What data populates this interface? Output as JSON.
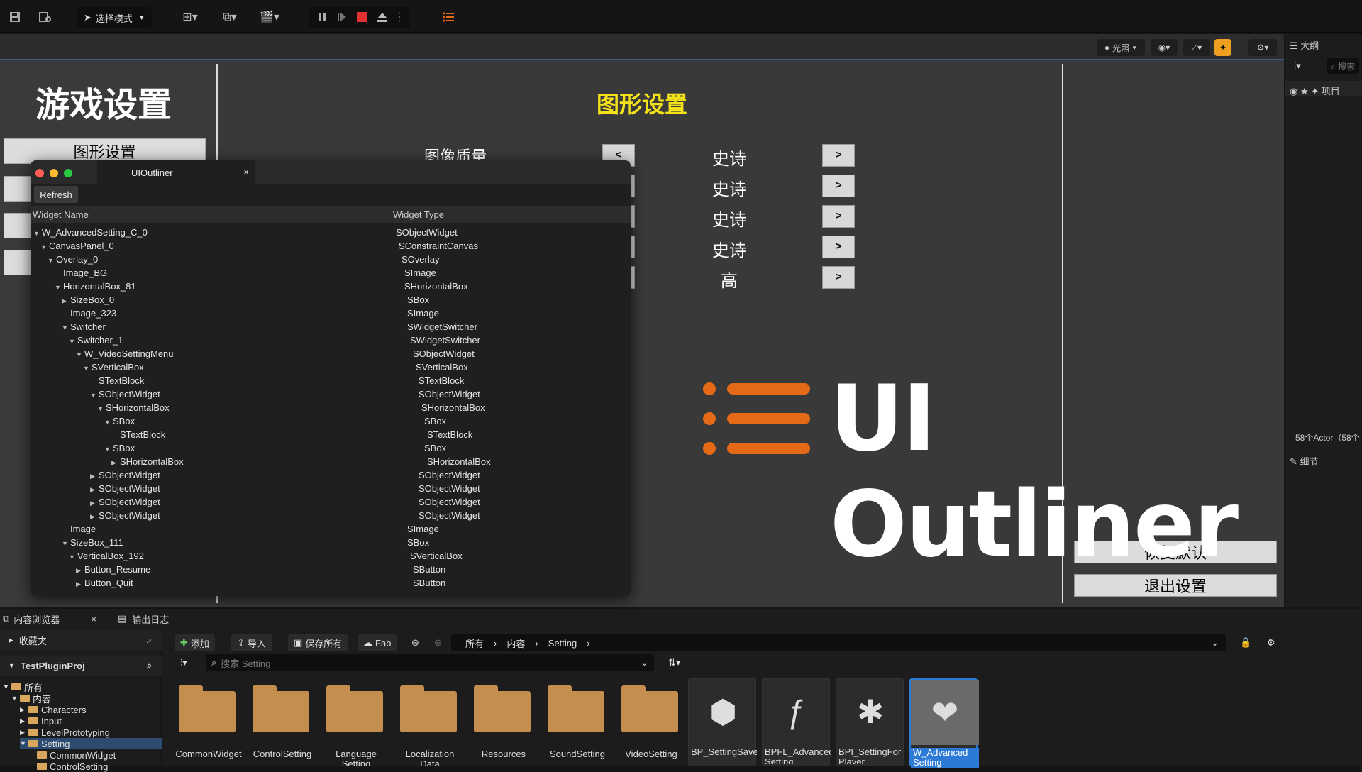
{
  "toolbar": {
    "mode_label": "选择模式"
  },
  "viewport_bar": {
    "lighting_label": "光照"
  },
  "game": {
    "title": "游戏设置",
    "menu": [
      "图形设置"
    ],
    "section_title": "图形设置",
    "row1_label": "图像质量",
    "prev_glyph": "<",
    "next_glyph": ">",
    "values": [
      "史诗",
      "史诗",
      "史诗",
      "史诗",
      "高"
    ],
    "restore_label": "恢复默认",
    "exit_label": "退出设置"
  },
  "logo": {
    "text": "UI Outliner",
    "accent": "#e56a18"
  },
  "outliner_window": {
    "tab_title": "UIOutliner",
    "close_glyph": "×",
    "refresh_label": "Refresh",
    "col_name": "Widget Name",
    "col_type": "Widget Type",
    "rows": [
      {
        "name": "W_AdvancedSetting_C_0",
        "type": "SObjectWidget",
        "depth": 0,
        "exp": "open"
      },
      {
        "name": "CanvasPanel_0",
        "type": "SConstraintCanvas",
        "depth": 1,
        "exp": "open"
      },
      {
        "name": "Overlay_0",
        "type": "SOverlay",
        "depth": 2,
        "exp": "open"
      },
      {
        "name": "Image_BG",
        "type": "SImage",
        "depth": 3,
        "exp": "none"
      },
      {
        "name": "HorizontalBox_81",
        "type": "SHorizontalBox",
        "depth": 3,
        "exp": "open"
      },
      {
        "name": "SizeBox_0",
        "type": "SBox",
        "depth": 4,
        "exp": "closed"
      },
      {
        "name": "Image_323",
        "type": "SImage",
        "depth": 4,
        "exp": "none"
      },
      {
        "name": "Switcher",
        "type": "SWidgetSwitcher",
        "depth": 4,
        "exp": "open"
      },
      {
        "name": "Switcher_1",
        "type": "SWidgetSwitcher",
        "depth": 5,
        "exp": "open"
      },
      {
        "name": "W_VideoSettingMenu",
        "type": "SObjectWidget",
        "depth": 6,
        "exp": "open"
      },
      {
        "name": "SVerticalBox",
        "type": "SVerticalBox",
        "depth": 7,
        "exp": "open"
      },
      {
        "name": "STextBlock",
        "type": "STextBlock",
        "depth": 8,
        "exp": "none"
      },
      {
        "name": "SObjectWidget",
        "type": "SObjectWidget",
        "depth": 8,
        "exp": "open"
      },
      {
        "name": "SHorizontalBox",
        "type": "SHorizontalBox",
        "depth": 9,
        "exp": "open"
      },
      {
        "name": "SBox",
        "type": "SBox",
        "depth": 10,
        "exp": "open"
      },
      {
        "name": "STextBlock",
        "type": "STextBlock",
        "depth": 11,
        "exp": "none"
      },
      {
        "name": "SBox",
        "type": "SBox",
        "depth": 10,
        "exp": "open"
      },
      {
        "name": "SHorizontalBox",
        "type": "SHorizontalBox",
        "depth": 11,
        "exp": "closed"
      },
      {
        "name": "SObjectWidget",
        "type": "SObjectWidget",
        "depth": 8,
        "exp": "closed"
      },
      {
        "name": "SObjectWidget",
        "type": "SObjectWidget",
        "depth": 8,
        "exp": "closed"
      },
      {
        "name": "SObjectWidget",
        "type": "SObjectWidget",
        "depth": 8,
        "exp": "closed"
      },
      {
        "name": "SObjectWidget",
        "type": "SObjectWidget",
        "depth": 8,
        "exp": "closed"
      },
      {
        "name": "Image",
        "type": "SImage",
        "depth": 4,
        "exp": "none"
      },
      {
        "name": "SizeBox_111",
        "type": "SBox",
        "depth": 4,
        "exp": "open"
      },
      {
        "name": "VerticalBox_192",
        "type": "SVerticalBox",
        "depth": 5,
        "exp": "open"
      },
      {
        "name": "Button_Resume",
        "type": "SButton",
        "depth": 6,
        "exp": "closed"
      },
      {
        "name": "Button_Quit",
        "type": "SButton",
        "depth": 6,
        "exp": "closed"
      }
    ]
  },
  "right_panel": {
    "outline_title": "大纲",
    "search_placeholder": "搜索",
    "project_col": "项目",
    "actor_count": "58个Actor（58个",
    "details_title": "细节"
  },
  "bottom": {
    "tab_content": "内容浏览器",
    "tab_close": "×",
    "tab_log": "输出日志",
    "favorites": "收藏夹",
    "project": "TestPluginProj",
    "tree": [
      {
        "label": "所有",
        "depth": 0
      },
      {
        "label": "内容",
        "depth": 1
      },
      {
        "label": "Characters",
        "depth": 2
      },
      {
        "label": "Input",
        "depth": 2
      },
      {
        "label": "LevelPrototyping",
        "depth": 2
      },
      {
        "label": "Setting",
        "depth": 2
      },
      {
        "label": "CommonWidget",
        "depth": 3
      },
      {
        "label": "ControlSetting",
        "depth": 3
      }
    ],
    "add_label": "添加",
    "import_label": "导入",
    "save_all_label": "保存所有",
    "fab_label": "Fab",
    "breadcrumb": [
      "所有",
      "内容",
      "Setting"
    ],
    "search_placeholder": "搜索 Setting",
    "folders": [
      "CommonWidget",
      "ControlSetting",
      "Language Setting",
      "Localization Data",
      "Resources",
      "SoundSetting",
      "VideoSetting"
    ],
    "assets": [
      "BP_SettingSave",
      "BPFL_Advanced Setting",
      "BPI_SettingFor Player",
      "W_Advanced Setting"
    ]
  }
}
